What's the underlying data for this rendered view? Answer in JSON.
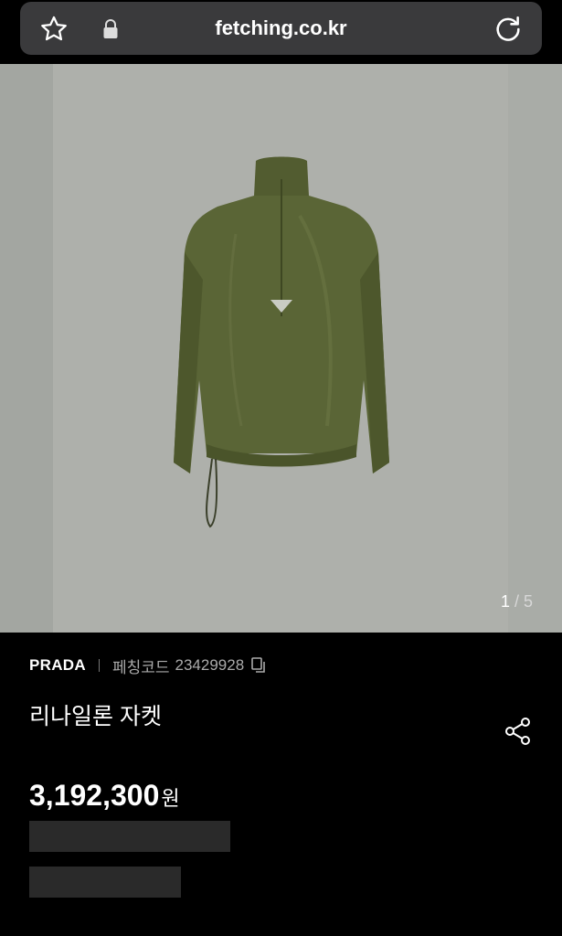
{
  "browser": {
    "url": "fetching.co.kr",
    "icons": {
      "bookmark": "star-icon",
      "secure": "lock-icon",
      "reload": "reload-icon"
    }
  },
  "gallery": {
    "current": "1",
    "separator": " / ",
    "total": "5",
    "image": "olive-green-nylon-half-zip-jacket"
  },
  "product": {
    "brand": "PRADA",
    "code_label": "페칭코드",
    "code_value": "23429928",
    "name": "리나일론 자켓",
    "price_value": "3,192,300",
    "price_unit": "원"
  },
  "colors": {
    "background": "#000000",
    "urlbar": "#3a3a3c",
    "jacket": "#5a6536",
    "gallery_bg": "#aeb0ab",
    "skeleton": "#2a2a2a"
  }
}
